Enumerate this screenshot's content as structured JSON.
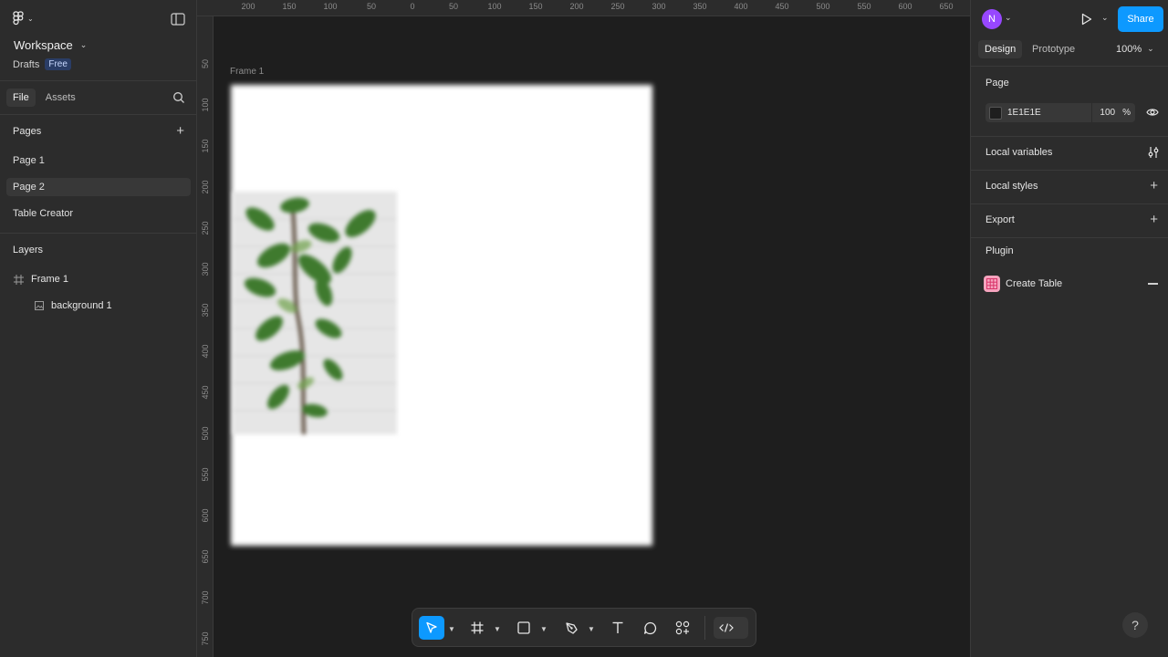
{
  "workspace": {
    "title": "Workspace",
    "subtitle": "Drafts",
    "plan_badge": "Free"
  },
  "left_tabs": [
    "File",
    "Assets"
  ],
  "pages": {
    "heading": "Pages",
    "items": [
      "Page 1",
      "Page 2",
      "Table Creator"
    ],
    "selected": "Page 2"
  },
  "layers": {
    "heading": "Layers",
    "items": [
      {
        "name": "Frame 1",
        "icon": "frame-icon"
      },
      {
        "name": "background 1",
        "icon": "image-icon"
      }
    ]
  },
  "ruler": {
    "top_ticks": [
      "200",
      "150",
      "100",
      "50",
      "0",
      "50",
      "100",
      "150",
      "200",
      "250",
      "300",
      "350",
      "400",
      "450",
      "500",
      "550",
      "600",
      "650"
    ],
    "left_ticks": [
      "50",
      "100",
      "150",
      "200",
      "250",
      "300",
      "350",
      "400",
      "450",
      "500",
      "550",
      "600",
      "650",
      "700",
      "750"
    ]
  },
  "canvas": {
    "frame_label": "Frame 1",
    "frame_color": "#ffffff",
    "background": "#1e1e1e"
  },
  "header_right": {
    "avatar_initial": "N",
    "avatar_color": "#9747ff",
    "share_label": "Share",
    "share_color": "#0d99ff"
  },
  "right_tabs": [
    "Design",
    "Prototype"
  ],
  "zoom": "100%",
  "design_panel": {
    "page_heading": "Page",
    "page_color_hex": "1E1E1E",
    "page_opacity": "100",
    "page_opacity_unit": "%",
    "local_variables": "Local variables",
    "local_styles": "Local styles",
    "export": "Export",
    "plugin_heading": "Plugin",
    "plugin_name": "Create Table"
  },
  "help_label": "?",
  "accent_color": "#0d99ff"
}
